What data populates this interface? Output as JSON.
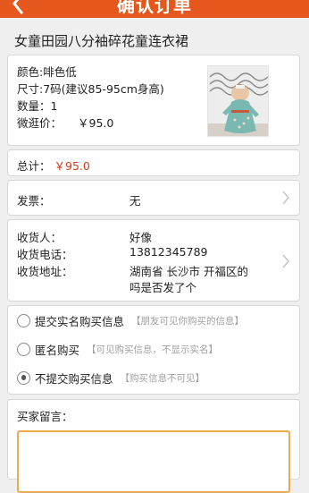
{
  "header": {
    "title": "确认订单",
    "back_icon": "chevron-left-icon",
    "color": "#e5571c"
  },
  "product": {
    "name": "女童田园八分袖碎花童连衣裙",
    "color_line": "颜色:啡色低",
    "size_line": "尺寸:7码(建议85-95cm身高)",
    "quantity_line": "数量：1",
    "price_label": "微逛价：",
    "price_value": "￥95.0",
    "image": "product-photo"
  },
  "total": {
    "label": "总计：",
    "value": "￥95.0",
    "color": "#d33b1a"
  },
  "invoice": {
    "label": "发票：",
    "value": "无"
  },
  "recipient": {
    "name_label": "收货人：",
    "name_value": "好像",
    "phone_label": "收货电话：",
    "phone_value": "13812345789",
    "address_label": "收货地址：",
    "address_line1": "湖南省 长沙市 开福区的",
    "address_line2": "吗是否发了个"
  },
  "purchase_options": [
    {
      "label": "提交实名购买信息",
      "hint": "【朋友可见你购买的信息】",
      "selected": false
    },
    {
      "label": "匿名购买",
      "hint": "【可见购买信息，不显示实名】",
      "selected": false
    },
    {
      "label": "不提交购买信息",
      "hint": "【购买信息不可见】",
      "selected": true
    }
  ],
  "message": {
    "label": "买家留言：",
    "value": ""
  }
}
